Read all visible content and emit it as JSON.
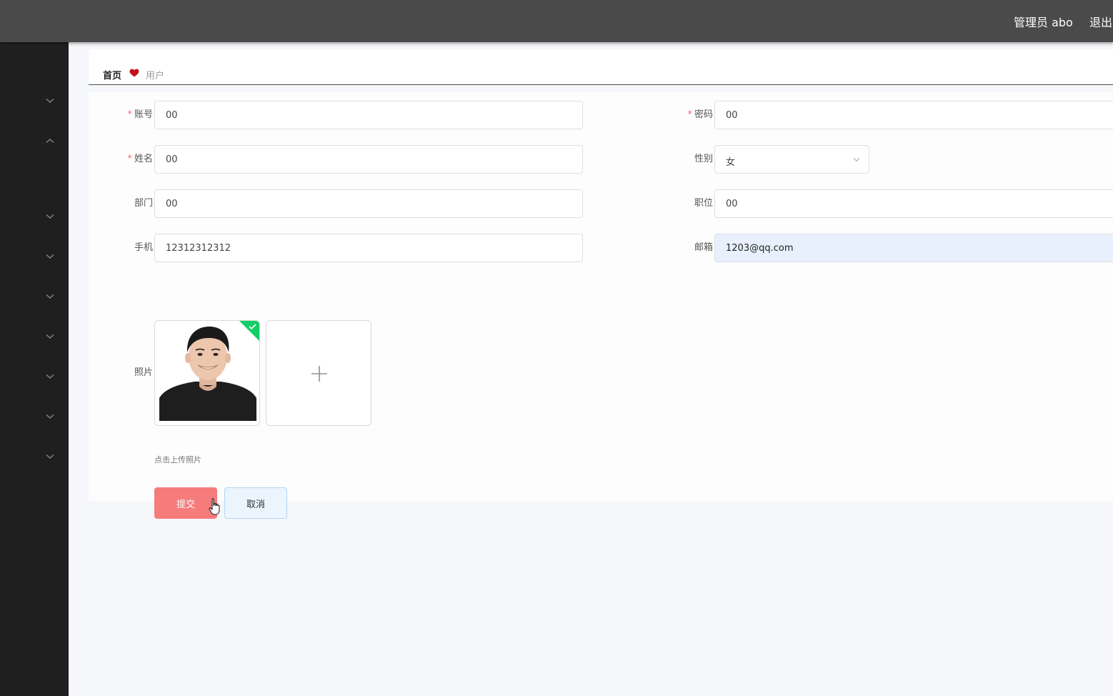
{
  "header": {
    "user_label": "管理员 abo",
    "logout_label": "退出"
  },
  "sidebar": {
    "items": [
      {
        "icon": "chevron-down-icon"
      },
      {
        "icon": "chevron-up-icon"
      },
      {
        "icon": "chevron-down-icon"
      },
      {
        "icon": "chevron-down-icon"
      },
      {
        "icon": "chevron-down-icon"
      },
      {
        "icon": "chevron-down-icon"
      },
      {
        "icon": "chevron-down-icon"
      },
      {
        "icon": "chevron-down-icon"
      },
      {
        "icon": "chevron-down-icon"
      }
    ]
  },
  "breadcrumb": {
    "home": "首页",
    "separator_icon": "heart-icon",
    "current": "用户"
  },
  "form": {
    "account": {
      "label": "账号",
      "value": "00"
    },
    "password": {
      "label": "密码",
      "value": "00"
    },
    "name": {
      "label": "姓名",
      "value": "00"
    },
    "gender": {
      "label": "性别",
      "value": "女"
    },
    "department": {
      "label": "部门",
      "value": "00"
    },
    "position": {
      "label": "职位",
      "value": "00"
    },
    "phone": {
      "label": "手机",
      "value": "12312312312"
    },
    "email": {
      "label": "邮箱",
      "value": "1203@qq.com"
    },
    "photo": {
      "label": "照片",
      "tip": "点击上传照片"
    },
    "required_mark": "*",
    "submit_label": "提交",
    "cancel_label": "取消"
  },
  "colors": {
    "topbar": "#4a4a4a",
    "sidebar": "#1f1f1f",
    "submit": "#f67b7b",
    "required": "#f56c6c",
    "success_badge": "#13ce66"
  }
}
